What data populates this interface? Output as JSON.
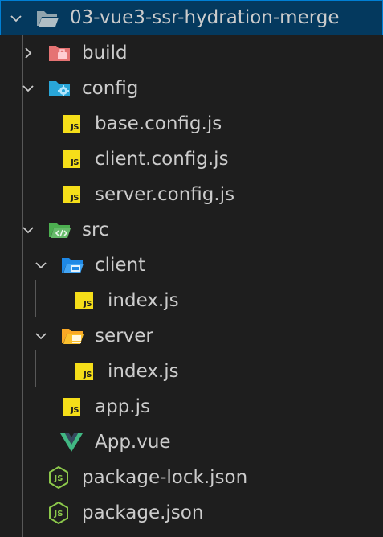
{
  "colors": {
    "background": "#1e1e1e",
    "selected_bg": "#04395e",
    "selected_border": "#007fd4",
    "text": "#cccccc",
    "js_yellow": "#f5de19",
    "vue_green": "#41b883",
    "node_green": "#8cc84b"
  },
  "explorer": {
    "root": {
      "label": "03-vue3-ssr-hydration-merge",
      "icon": "folder-open-icon",
      "expanded": true
    },
    "items": [
      {
        "label": "build",
        "icon": "folder-build-icon",
        "expanded": false
      },
      {
        "label": "config",
        "icon": "folder-config-icon",
        "expanded": true
      },
      {
        "label": "base.config.js",
        "icon": "js-file-icon",
        "badge": "JS"
      },
      {
        "label": "client.config.js",
        "icon": "js-file-icon",
        "badge": "JS"
      },
      {
        "label": "server.config.js",
        "icon": "js-file-icon",
        "badge": "JS"
      },
      {
        "label": "src",
        "icon": "folder-src-icon",
        "expanded": true
      },
      {
        "label": "client",
        "icon": "folder-client-icon",
        "expanded": true
      },
      {
        "label": "index.js",
        "icon": "js-file-icon",
        "badge": "JS"
      },
      {
        "label": "server",
        "icon": "folder-server-icon",
        "expanded": true
      },
      {
        "label": "index.js",
        "icon": "js-file-icon",
        "badge": "JS"
      },
      {
        "label": "app.js",
        "icon": "js-file-icon",
        "badge": "JS"
      },
      {
        "label": "App.vue",
        "icon": "vue-file-icon"
      },
      {
        "label": "package-lock.json",
        "icon": "nodejs-file-icon"
      },
      {
        "label": "package.json",
        "icon": "nodejs-file-icon"
      }
    ]
  }
}
